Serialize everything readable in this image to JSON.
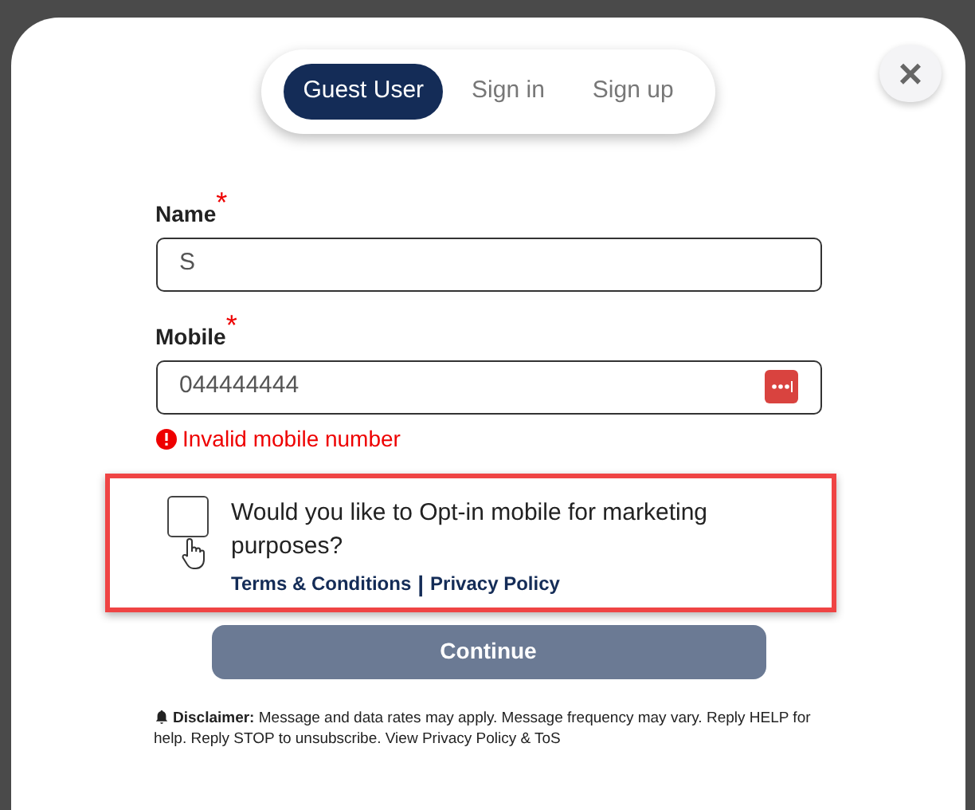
{
  "tabs": [
    {
      "label": "Guest User",
      "selected": true
    },
    {
      "label": "Sign in",
      "selected": false
    },
    {
      "label": "Sign up",
      "selected": false
    }
  ],
  "close": "×",
  "fields": [
    {
      "label": "Name",
      "required_mark": "*",
      "value": "S",
      "error": false
    },
    {
      "label": "Mobile",
      "required_mark": "*",
      "value": "044444444",
      "error": true,
      "error_text": "Invalid mobile number"
    }
  ],
  "opt_in": {
    "checked": false,
    "text": "Would you like to Opt-in mobile for marketing purposes?",
    "links": [
      "Terms & Conditions",
      "Privacy Policy"
    ],
    "separator": "|",
    "highlighted": true
  },
  "continue_button": {
    "label": "Continue",
    "disabled": true
  },
  "disclaimer": "**Disclaimer:** Message and data rates may apply. Message frequency may vary. Reply HELP for help. Reply STOP to unsubscribe. View Privacy Policy & ToS"
}
